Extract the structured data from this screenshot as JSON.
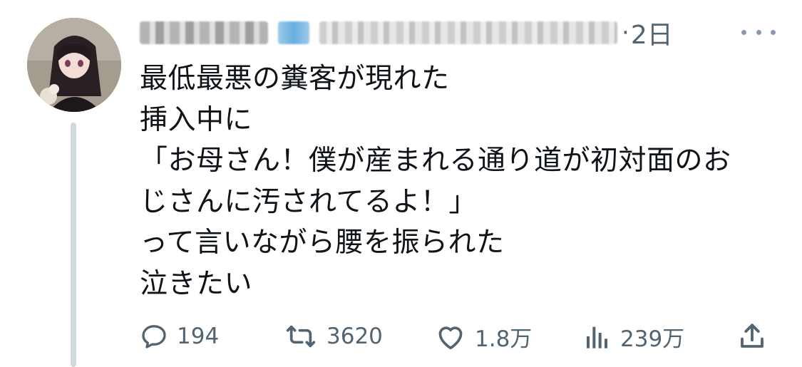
{
  "tweet": {
    "timestamp": "2日",
    "separator": "·",
    "lines": [
      "最低最悪の糞客が現れた",
      "挿入中に",
      "「お母さん！僕が産まれる通り道が初対面のお",
      "じさんに汚されてるよ！」",
      "って言いながら腰を振られた",
      "泣きたい"
    ]
  },
  "actions": {
    "reply_count": "194",
    "retweet_count": "3620",
    "like_count": "1.8万",
    "view_count": "239万"
  },
  "icons": {
    "reply": "reply-icon",
    "retweet": "retweet-icon",
    "like": "heart-icon",
    "views": "views-icon",
    "share": "share-icon",
    "more": "more-icon"
  },
  "colors": {
    "text": "#0f1419",
    "muted": "#536471",
    "thread_line": "#cfd9de"
  }
}
